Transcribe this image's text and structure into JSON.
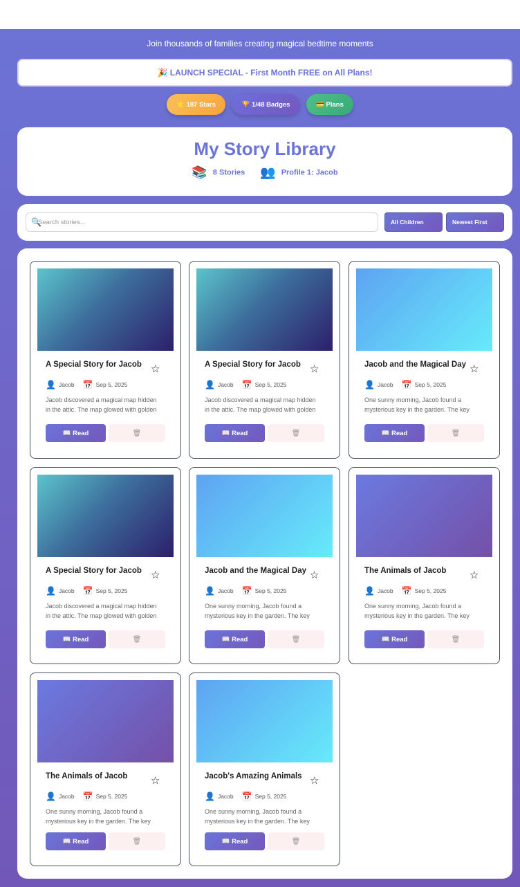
{
  "tagline": "Join thousands of families creating magical bedtime moments",
  "promo": "🎉 LAUNCH SPECIAL - First Month FREE on All Plans!",
  "pills": {
    "stars": "⭐ 187 Stars",
    "badges": "🏆 1/48 Badges",
    "plans": "💳 Plans"
  },
  "library": {
    "title": "My Story Library",
    "stories_count": "8 Stories",
    "stories_icon": "📚",
    "profile": "Profile 1: Jacob",
    "profile_icon": "👥"
  },
  "filters": {
    "search_placeholder": "Search stories...",
    "search_icon": "🔍",
    "children": "All Children",
    "sort": "Newest First"
  },
  "stories": [
    {
      "title": "A Special Story for Jacob",
      "child": "Jacob",
      "date": "Sep 5, 2025",
      "desc": "Jacob discovered a magical map hidden in the attic. The map glowed with golden light and showed a path to",
      "thumb": "teal"
    },
    {
      "title": "A Special Story for Jacob",
      "child": "Jacob",
      "date": "Sep 5, 2025",
      "desc": "Jacob discovered a magical map hidden in the attic. The map glowed with golden light and showed a path to",
      "thumb": "teal"
    },
    {
      "title": "Jacob and the Magical Day",
      "child": "Jacob",
      "date": "Sep 5, 2025",
      "desc": "One sunny morning, Jacob found a mysterious key in the garden. The key sparkled",
      "thumb": "sky"
    },
    {
      "title": "A Special Story for Jacob",
      "child": "Jacob",
      "date": "Sep 5, 2025",
      "desc": "Jacob discovered a magical map hidden in the attic. The map glowed with golden light",
      "thumb": "teal"
    },
    {
      "title": "Jacob and the Magical Day",
      "child": "Jacob",
      "date": "Sep 5, 2025",
      "desc": "One sunny morning, Jacob found a mysterious key in the garden. The key sparkled",
      "thumb": "sky"
    },
    {
      "title": "The Animals of Jacob",
      "child": "Jacob",
      "date": "Sep 5, 2025",
      "desc": "One sunny morning, Jacob found a mysterious key in the garden. The key sparkled",
      "thumb": "purple"
    },
    {
      "title": "The Animals of Jacob",
      "child": "Jacob",
      "date": "Sep 5, 2025",
      "desc": "One sunny morning, Jacob found a mysterious key in the garden. The key sparkled",
      "thumb": "purple"
    },
    {
      "title": "Jacob's Amazing Animals",
      "child": "Jacob",
      "date": "Sep 5, 2025",
      "desc": "One sunny morning, Jacob found a mysterious key in the garden. The key sparkled",
      "thumb": "sky"
    }
  ],
  "labels": {
    "read": "📖 Read",
    "delete_icon": "🗑",
    "favorite_icon": "☆",
    "child_icon": "👤",
    "date_icon": "📅"
  }
}
